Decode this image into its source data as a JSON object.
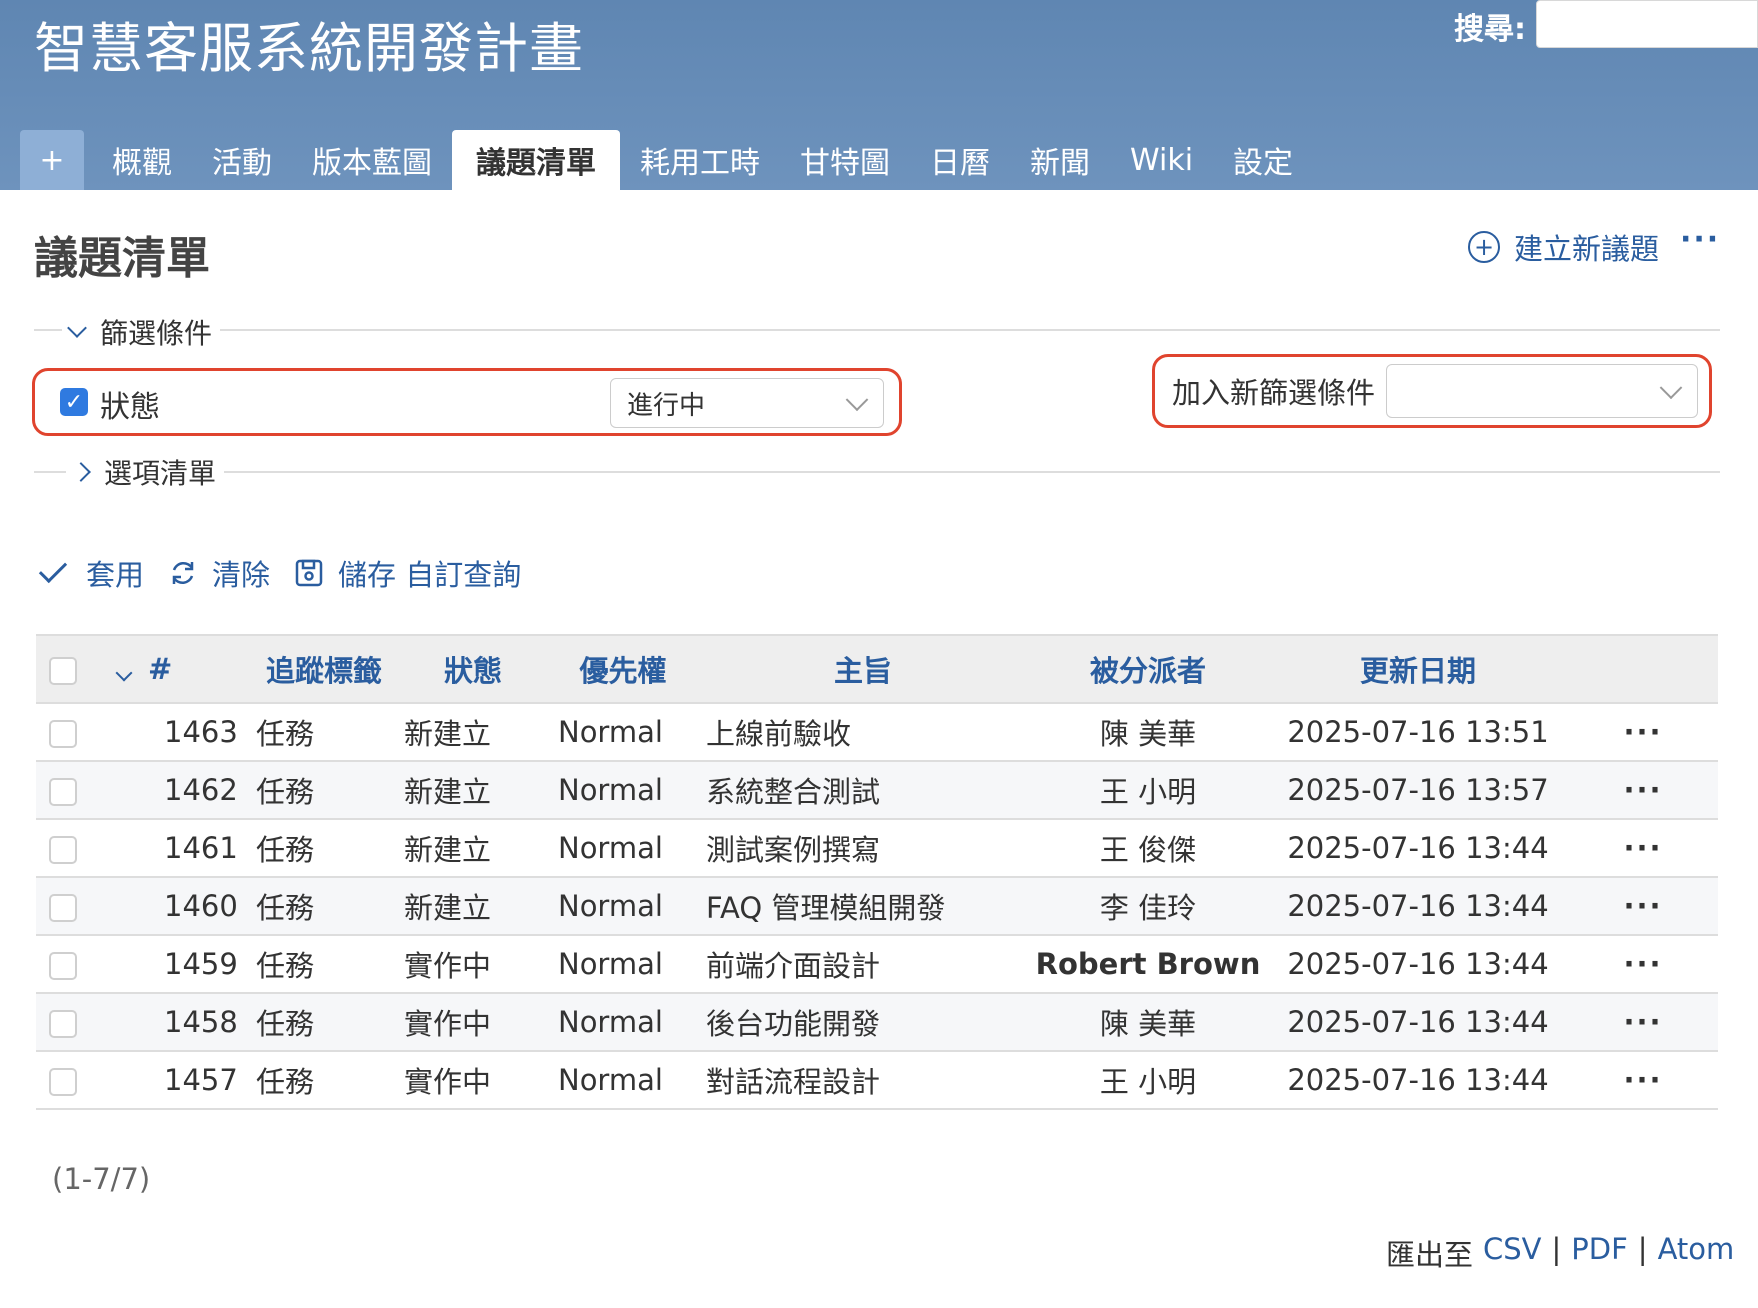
{
  "header": {
    "title": "智慧客服系統開發計畫",
    "search_label": "搜尋:",
    "search_value": ""
  },
  "tabs": {
    "add": "+",
    "items": [
      "概觀",
      "活動",
      "版本藍圖",
      "議題清單",
      "耗用工時",
      "甘特圖",
      "日曆",
      "新聞",
      "Wiki",
      "設定"
    ],
    "active": "議題清單"
  },
  "page": {
    "title": "議題清單",
    "new_issue": "建立新議題",
    "more": "···"
  },
  "filters": {
    "legend": "篩選條件",
    "status_label": "狀態",
    "status_checked": true,
    "status_value": "進行中",
    "add_filter_label": "加入新篩選條件",
    "add_filter_value": ""
  },
  "options": {
    "legend": "選項清單"
  },
  "actions": {
    "apply": "套用",
    "clear": "清除",
    "save": "儲存 自訂查詢"
  },
  "table": {
    "columns": [
      "#",
      "追蹤標籤",
      "狀態",
      "優先權",
      "主旨",
      "被分派者",
      "更新日期"
    ],
    "rows": [
      {
        "id": "1463",
        "tracker": "任務",
        "status": "新建立",
        "priority": "Normal",
        "subject": "上線前驗收",
        "assignee": "陳 美華",
        "updated": "2025-07-16 13:51"
      },
      {
        "id": "1462",
        "tracker": "任務",
        "status": "新建立",
        "priority": "Normal",
        "subject": "系統整合測試",
        "assignee": "王 小明",
        "updated": "2025-07-16 13:57"
      },
      {
        "id": "1461",
        "tracker": "任務",
        "status": "新建立",
        "priority": "Normal",
        "subject": "測試案例撰寫",
        "assignee": "王 俊傑",
        "updated": "2025-07-16 13:44"
      },
      {
        "id": "1460",
        "tracker": "任務",
        "status": "新建立",
        "priority": "Normal",
        "subject": "FAQ 管理模組開發",
        "assignee": "李 佳玲",
        "updated": "2025-07-16 13:44"
      },
      {
        "id": "1459",
        "tracker": "任務",
        "status": "實作中",
        "priority": "Normal",
        "subject": "前端介面設計",
        "assignee": "Robert Brown",
        "updated": "2025-07-16 13:44"
      },
      {
        "id": "1458",
        "tracker": "任務",
        "status": "實作中",
        "priority": "Normal",
        "subject": "後台功能開發",
        "assignee": "陳 美華",
        "updated": "2025-07-16 13:44"
      },
      {
        "id": "1457",
        "tracker": "任務",
        "status": "實作中",
        "priority": "Normal",
        "subject": "對話流程設計",
        "assignee": "王 小明",
        "updated": "2025-07-16 13:44"
      }
    ],
    "row_more": "···"
  },
  "footer": {
    "count": "(1-7/7)",
    "export_label": "匯出至",
    "csv": "CSV",
    "pdf": "PDF",
    "atom": "Atom",
    "sep": "|"
  }
}
